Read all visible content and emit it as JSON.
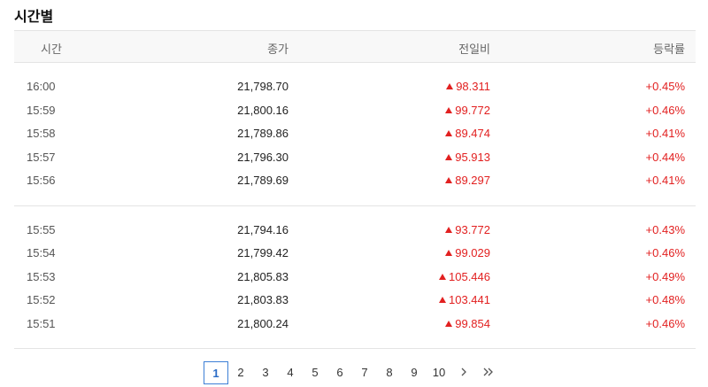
{
  "title": "시간별",
  "columns": {
    "time": "시간",
    "close": "종가",
    "change": "전일비",
    "rate": "등락률"
  },
  "groups": [
    [
      {
        "time": "16:00",
        "close": "21,798.70",
        "change": "98.311",
        "rate": "+0.45%"
      },
      {
        "time": "15:59",
        "close": "21,800.16",
        "change": "99.772",
        "rate": "+0.46%"
      },
      {
        "time": "15:58",
        "close": "21,789.86",
        "change": "89.474",
        "rate": "+0.41%"
      },
      {
        "time": "15:57",
        "close": "21,796.30",
        "change": "95.913",
        "rate": "+0.44%"
      },
      {
        "time": "15:56",
        "close": "21,789.69",
        "change": "89.297",
        "rate": "+0.41%"
      }
    ],
    [
      {
        "time": "15:55",
        "close": "21,794.16",
        "change": "93.772",
        "rate": "+0.43%"
      },
      {
        "time": "15:54",
        "close": "21,799.42",
        "change": "99.029",
        "rate": "+0.46%"
      },
      {
        "time": "15:53",
        "close": "21,805.83",
        "change": "105.446",
        "rate": "+0.49%"
      },
      {
        "time": "15:52",
        "close": "21,803.83",
        "change": "103.441",
        "rate": "+0.48%"
      },
      {
        "time": "15:51",
        "close": "21,800.24",
        "change": "99.854",
        "rate": "+0.46%"
      }
    ]
  ],
  "pagination": {
    "pages": [
      "1",
      "2",
      "3",
      "4",
      "5",
      "6",
      "7",
      "8",
      "9",
      "10"
    ],
    "current": "1",
    "next_icon": "chevron-right-icon",
    "last_icon": "double-chevron-right-icon"
  },
  "colors": {
    "up": "#e22020",
    "active_page": "#3d7fd6"
  }
}
